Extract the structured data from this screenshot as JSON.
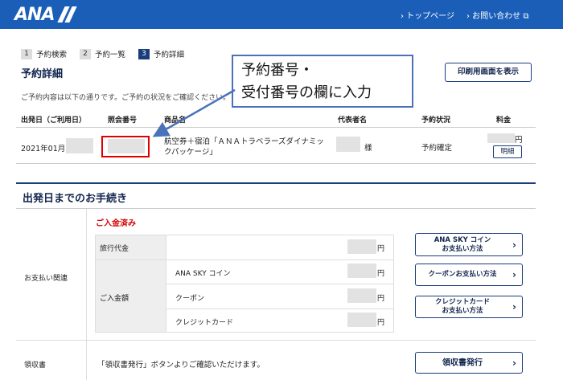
{
  "header": {
    "logo_text": "ANA",
    "nav": [
      {
        "label": "› トップページ"
      },
      {
        "label": "› お問い合わせ ⧉"
      }
    ]
  },
  "steps": [
    {
      "num": "1",
      "label": "予約検索"
    },
    {
      "num": "2",
      "label": "予約一覧"
    },
    {
      "num": "3",
      "label": "予約詳細"
    }
  ],
  "page_title": "予約詳細",
  "print_button": "印刷用画面を表示",
  "intro": "ご予約内容は以下の通りです。ご予約の状況をご確認ください。",
  "table": {
    "headers": [
      "出発日（ご利用日）",
      "照会番号",
      "商品名",
      "代表者名",
      "予約状況",
      "料金"
    ],
    "row": {
      "date": "2021年01月",
      "product": "航空券＋宿泊「ＡＮＡトラベラーズダイナミックパッケージ」",
      "name_suffix": "様",
      "status": "予約確定",
      "fee_unit": "円",
      "detail_button": "明細"
    }
  },
  "callout": {
    "line1": "予約番号・",
    "line2": "受付番号の欄に入力"
  },
  "section": {
    "title": "出発日までのお手続き",
    "payment_label": "お支払い関連",
    "paid_status": "ご入金済み",
    "rows": {
      "travel_fee": "旅行代金",
      "deposit": "ご入金額",
      "ana_sky_coin": "ANA SKY コイン",
      "coupon": "クーポン",
      "credit_card": "クレジットカード",
      "yen": "円"
    },
    "buttons": {
      "sky_coin": "ANA SKY コイン\nお支払い方法",
      "coupon": "クーポンお支払い方法",
      "credit": "クレジットカード\nお支払い方法"
    },
    "receipt": {
      "label": "領収書",
      "text": "「領収書発行」ボタンよりご確認いただけます。",
      "button": "領収書発行"
    }
  },
  "colors": {
    "brand_blue": "#1a5eb8",
    "navy": "#12254d",
    "alert_red": "#d60000"
  }
}
